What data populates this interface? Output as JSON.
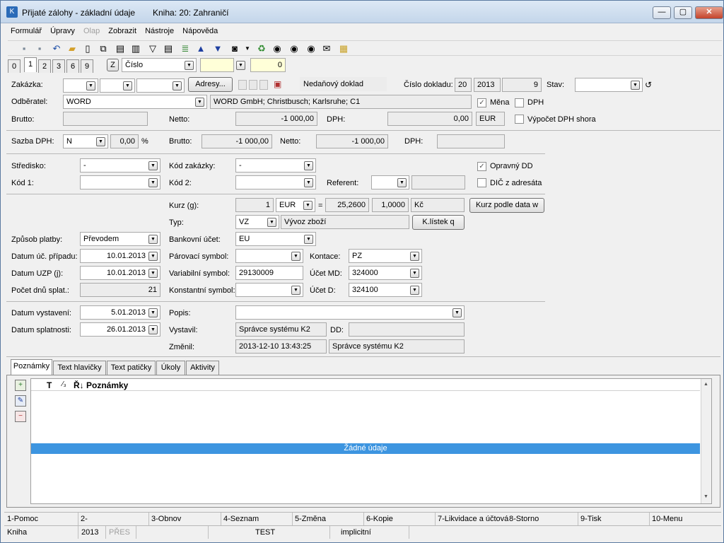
{
  "window": {
    "title": "Přijaté zálohy - základní údaje",
    "book": "Kniha: 20: Zahraničí",
    "minimize": "—",
    "restore": "▢",
    "close": "✕"
  },
  "menu": [
    "Formulář",
    "Úpravy",
    "Olap",
    "Zobrazit",
    "Nástroje",
    "Nápověda"
  ],
  "toolbar_icons": [
    "save-icon",
    "save-as-icon",
    "undo-icon",
    "open-folder-icon",
    "new-document-icon",
    "copy-icon",
    "document-list-icon",
    "book-icon",
    "filter-icon",
    "filter-list-icon",
    "stack-icon",
    "arrow-up-icon",
    "arrow-down-icon",
    "camera-icon",
    "dropdown-arrow-icon",
    "recycle-icon",
    "binoculars-icon",
    "binoculars-next-icon",
    "binoculars-filter-icon",
    "envelope-icon",
    "notebook-icon"
  ],
  "tabs": [
    "0",
    "1",
    "2",
    "3",
    "6",
    "9"
  ],
  "sortbar": {
    "z_label": "Z",
    "order_value": "Číslo",
    "counter": "0"
  },
  "labels": {
    "zakazka": "Zakázka:",
    "odberatel": "Odběratel:",
    "brutto": "Brutto:",
    "netto": "Netto:",
    "dph": "DPH:",
    "sazba_dph": "Sazba DPH:",
    "percent": "%",
    "stredisko": "Středisko:",
    "kod1": "Kód 1:",
    "kod_zakazky": "Kód zakázky:",
    "kod2": "Kód 2:",
    "referent": "Referent:",
    "kurz": "Kurz (g):",
    "typ": "Typ:",
    "zpusob_platby": "Způsob platby:",
    "bankovni_ucet": "Bankovní účet:",
    "datum_uc": "Datum úč. případu:",
    "parovaci": "Párovací symbol:",
    "kontace": "Kontace:",
    "datum_uzp": "Datum UZP (j):",
    "variabilni": "Variabilní symbol:",
    "ucet_md": "Účet MD:",
    "pocet_dnu": "Počet dnů splat.:",
    "konstantni": "Konstantní symbol:",
    "ucet_d": "Účet D:",
    "datum_vystaveni": "Datum vystavení:",
    "datum_splatnosti": "Datum splatnosti:",
    "popis": "Popis:",
    "vystavil": "Vystavil:",
    "zmenil": "Změnil:",
    "dd": "DD:",
    "cislo_dokladu": "Číslo dokladu:",
    "stav": "Stav:",
    "equals": "="
  },
  "buttons": {
    "adresy": "Adresy...",
    "kurz_podle_data": "Kurz podle data w",
    "k_listek": "K.lístek q"
  },
  "checkboxes": {
    "mena": {
      "label": "Měna",
      "checked": true
    },
    "dph": {
      "label": "DPH",
      "checked": false
    },
    "vypocet_dph_shora": {
      "label": "Výpočet DPH shora",
      "checked": false
    },
    "opravny_dd": {
      "label": "Opravný DD",
      "checked": true
    },
    "dic_z_adresata": {
      "label": "DIČ z adresáta",
      "checked": false
    }
  },
  "values": {
    "doc_type": "Nedaňový doklad",
    "cislo_kniha": "20",
    "cislo_rok": "2013",
    "cislo_poradi": "9",
    "odberatel": "WORD",
    "odberatel_adresa": "WORD GmbH; Christbusch; Karlsruhe; C1",
    "brutto": "-1 000,00",
    "netto": "-1 000,00",
    "dph": "0,00",
    "mena": "EUR",
    "sazba": "N",
    "sazba_pct": "0,00",
    "brutto2": "-1 000,00",
    "netto2": "-1 000,00",
    "stredisko": "-",
    "kod_zakazky": "-",
    "kurz_mnozstvi": "1",
    "kurz_mena": "EUR",
    "kurz": "25,2600",
    "kurz_pomer": "1,0000",
    "kurz_kc": "Kč",
    "typ": "VZ",
    "typ_popis": "Vývoz zboží",
    "zpusob_platby": "Převodem",
    "bankovni_ucet": "EU",
    "datum_uc": "10.01.2013",
    "kontace": "PZ",
    "datum_uzp": "10.01.2013",
    "variabilni": "29130009",
    "ucet_md": "324000",
    "pocet_dnu": "21",
    "ucet_d": "324100",
    "datum_vystaveni": "5.01.2013",
    "datum_splatnosti": "26.01.2013",
    "vystavil": "Správce systému K2",
    "zmenil_datum": "2013-12-10 13:43:25",
    "zmenil_kdo": "Správce systému K2"
  },
  "bottom_tabs": [
    "Poznámky",
    "Text hlavičky",
    "Text patičky",
    "Úkoly",
    "Aktivity"
  ],
  "grid": {
    "columns": [
      "T",
      "⁄₃",
      "Ř↓",
      "Poznámky"
    ],
    "empty": "Žádné údaje",
    "side_icons": [
      "add-note-icon",
      "edit-note-icon",
      "delete-note-icon"
    ]
  },
  "fkeys": [
    "1-Pomoc",
    "2-",
    "3-Obnov",
    "4-Seznam",
    "5-Změna",
    "6-Kopie",
    "7-Likvidace a účtová",
    "8-Storno",
    "9-Tisk",
    "10-Menu"
  ],
  "status": [
    "Kniha",
    "2013",
    "PŘES",
    "",
    "TEST",
    "implicitní"
  ],
  "colors": {
    "accent": "#3d95e0",
    "title_gradient": "#c4d6ea"
  }
}
